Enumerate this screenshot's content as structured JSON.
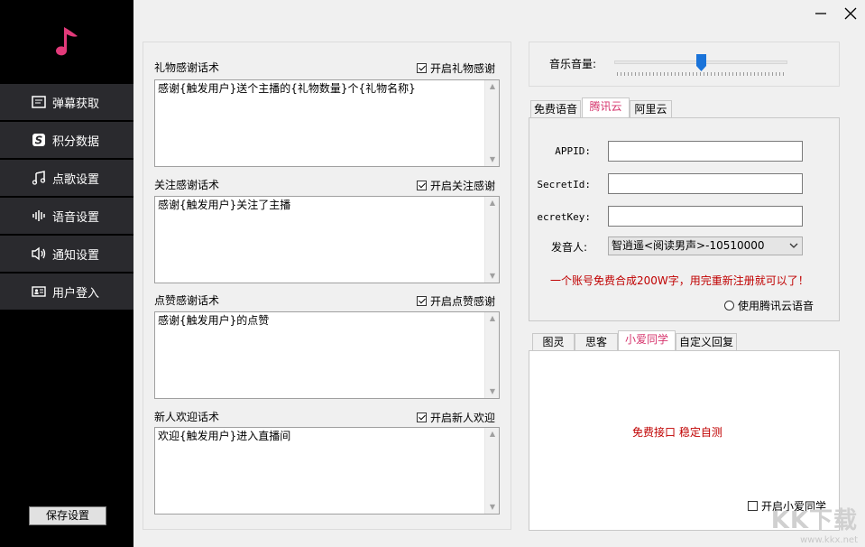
{
  "sidebar": {
    "items": [
      {
        "label": "弹幕获取",
        "icon": "screen-icon"
      },
      {
        "label": "积分数据",
        "icon": "s-logo-icon"
      },
      {
        "label": "点歌设置",
        "icon": "music-note-icon"
      },
      {
        "label": "语音设置",
        "icon": "waveform-icon"
      },
      {
        "label": "通知设置",
        "icon": "speaker-icon"
      },
      {
        "label": "用户登入",
        "icon": "id-card-icon"
      }
    ],
    "save_label": "保存设置"
  },
  "left_panel": {
    "sections": [
      {
        "title": "礼物感谢话术",
        "check_label": "开启礼物感谢",
        "checked": true,
        "text": "感谢{触发用户}送个主播的{礼物数量}个{礼物名称}"
      },
      {
        "title": "关注感谢话术",
        "check_label": "开启关注感谢",
        "checked": true,
        "text": "感谢{触发用户}关注了主播"
      },
      {
        "title": "点赞感谢话术",
        "check_label": "开启点赞感谢",
        "checked": true,
        "text": "感谢{触发用户}的点赞"
      },
      {
        "title": "新人欢迎话术",
        "check_label": "开启新人欢迎",
        "checked": true,
        "text": "欢迎{触发用户}进入直播间"
      }
    ]
  },
  "volume": {
    "label": "音乐音量:",
    "level": 0.5
  },
  "voice_tabs": {
    "tabs": [
      "免费语音",
      "腾讯云",
      "阿里云"
    ],
    "active": 1,
    "fields": {
      "appid_label": "APPID:",
      "secretid_label": "SecretId:",
      "secretkey_label": "ecretKey:",
      "speaker_label": "发音人:",
      "speaker_value": "智逍遥<阅读男声>-10510000",
      "appid_value": "",
      "secretid_value": "",
      "secretkey_value": ""
    },
    "notice": "一个账号免费合成200W字，用完重新注册就可以了！",
    "radio_label": "使用腾讯云语音"
  },
  "bot_tabs": {
    "tabs": [
      "图灵",
      "思客",
      "小爱同学",
      "自定义回复"
    ],
    "active": 2,
    "notice": "免费接口  稳定自测",
    "check_label": "开启小爱同学"
  },
  "watermark": {
    "text": "KK下载",
    "url": "www.kkx.net"
  },
  "colors": {
    "accent": "#d6356d",
    "sidebar_bg": "#000000",
    "nav_item_bg": "#2a2a2e",
    "slider_thumb": "#1a73d9",
    "notice_red": "#c00000"
  }
}
